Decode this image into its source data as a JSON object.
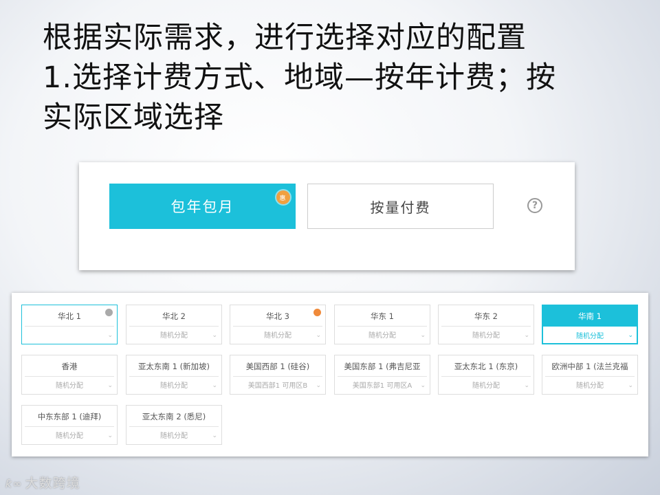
{
  "slide": {
    "title_lines": [
      "根据实际需求，进行选择对应的配置",
      "1.选择计费方式、地域—按年计费；按",
      "实际区域选择"
    ]
  },
  "billing": {
    "annual_label": "包年包月",
    "annual_badge": "惠",
    "payg_label": "按量付费",
    "help_glyph": "?"
  },
  "regions": [
    {
      "name": "华北 1",
      "zone": "",
      "badge": "info"
    },
    {
      "name": "华北 2",
      "zone": "随机分配"
    },
    {
      "name": "华北 3",
      "zone": "随机分配",
      "badge": "new"
    },
    {
      "name": "华东 1",
      "zone": "随机分配"
    },
    {
      "name": "华东 2",
      "zone": "随机分配"
    },
    {
      "name": "华南 1",
      "zone": "随机分配",
      "selected": true
    },
    {
      "name": "香港",
      "zone": "随机分配"
    },
    {
      "name": "亚太东南 1 (新加坡)",
      "zone": "随机分配"
    },
    {
      "name": "美国西部 1 (硅谷)",
      "zone": "美国西部1 可用区B"
    },
    {
      "name": "美国东部 1 (弗吉尼亚",
      "zone": "美国东部1 可用区A"
    },
    {
      "name": "亚太东北 1 (东京)",
      "zone": "随机分配"
    },
    {
      "name": "欧洲中部 1 (法兰克福",
      "zone": "随机分配"
    },
    {
      "name": "中东东部 1 (迪拜)",
      "zone": "随机分配"
    },
    {
      "name": "亚太东南 2 (悉尼)",
      "zone": "随机分配"
    }
  ],
  "watermark": {
    "logo": "ƙ∞",
    "text": "大数跨境"
  },
  "colors": {
    "accent": "#1cc0da",
    "badge_orange": "#f08a3a"
  }
}
